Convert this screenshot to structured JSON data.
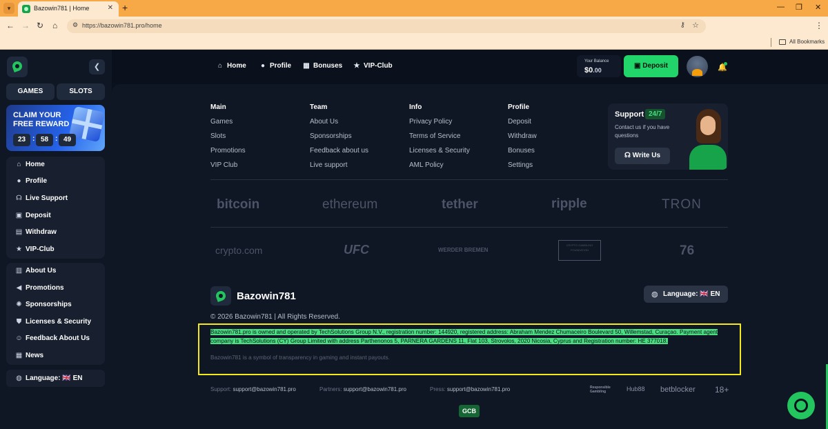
{
  "browser": {
    "tab_title": "Bazowin781 | Home",
    "url": "https://bazowin781.pro/home",
    "bookmarks_label": "All Bookmarks"
  },
  "sidebar": {
    "categories": [
      "GAMES",
      "SLOTS"
    ],
    "reward": {
      "title": "CLAIM YOUR FREE REWARD",
      "timer": [
        "23",
        "58",
        "49"
      ]
    },
    "menu1": [
      {
        "label": "Home",
        "icon": "home-icon"
      },
      {
        "label": "Profile",
        "icon": "user-icon"
      },
      {
        "label": "Live Support",
        "icon": "headset-icon"
      },
      {
        "label": "Deposit",
        "icon": "deposit-icon"
      },
      {
        "label": "Withdraw",
        "icon": "withdraw-icon"
      },
      {
        "label": "VIP-Club",
        "icon": "star-icon"
      }
    ],
    "menu2": [
      {
        "label": "About Us",
        "icon": "building-icon"
      },
      {
        "label": "Promotions",
        "icon": "megaphone-icon"
      },
      {
        "label": "Sponsorships",
        "icon": "handshake-icon"
      },
      {
        "label": "Licenses & Security",
        "icon": "shield-icon"
      },
      {
        "label": "Feedback About Us",
        "icon": "feedback-icon"
      },
      {
        "label": "News",
        "icon": "news-icon"
      }
    ],
    "language": "Language: 🇬🇧 EN"
  },
  "topnav": {
    "items": [
      {
        "label": "Home",
        "icon": "home-icon"
      },
      {
        "label": "Profile",
        "icon": "user-icon"
      },
      {
        "label": "Bonuses",
        "icon": "gift-icon"
      },
      {
        "label": "VIP-Club",
        "icon": "star-icon"
      }
    ],
    "balance_label": "Your Balance",
    "balance_whole": "$0",
    "balance_cents": ".00",
    "deposit_label": "Deposit"
  },
  "footer": {
    "columns": [
      {
        "title": "Main",
        "links": [
          "Games",
          "Slots",
          "Promotions",
          "VIP Club"
        ]
      },
      {
        "title": "Team",
        "links": [
          "About Us",
          "Sponsorships",
          "Feedback about us",
          "Live support"
        ]
      },
      {
        "title": "Info",
        "links": [
          "Privacy Policy",
          "Terms of Service",
          "Licenses & Security",
          "AML Policy"
        ]
      },
      {
        "title": "Profile",
        "links": [
          "Deposit",
          "Withdraw",
          "Bonuses",
          "Settings"
        ]
      }
    ],
    "support": {
      "title": "Support",
      "badge": "24/7",
      "text": "Contact us if you have questions",
      "button": "Write Us"
    },
    "payment_logos": [
      "bitcoin",
      "ethereum",
      "tether",
      "ripple",
      "TRON"
    ],
    "partner_logos": [
      "crypto.com",
      "UFC",
      "WERDER BREMEN",
      "CRYPTO GAMBLING FOUNDATION",
      "76"
    ],
    "brand_name": "Bazowin781",
    "language": "Language: 🇬🇧 EN",
    "copyright": "© 2026 Bazowin781 | All Rights Reserved.",
    "legal": "Bazowin781.pro is owned and operated by TechSolutions Group N.V., registration number: 144920, registered address: Abraham Mendez Chumaceiro Boulevard 50, Willemstad, Curaçao. Payment agent company is TechSolutions (CY) Group Limited with address Parthenonos 5, PARNERA GARDENS 11, Flat 103, Strovolos, 2020 Nicosia, Cyprus and Registration number: HE 377018.",
    "legal_sub": "Bazowin781 is a symbol of transparency in gaming and instant payouts.",
    "contacts": [
      {
        "label": "Support:",
        "email": "support@bazowin781.pro"
      },
      {
        "label": "Partners:",
        "email": "support@bazowin781.pro"
      },
      {
        "label": "Press:",
        "email": "support@bazowin781.pro"
      }
    ],
    "responsible": [
      "Responsible Gambling",
      "Hub88",
      "betblocker",
      "18+"
    ],
    "gcb": "GCB"
  }
}
